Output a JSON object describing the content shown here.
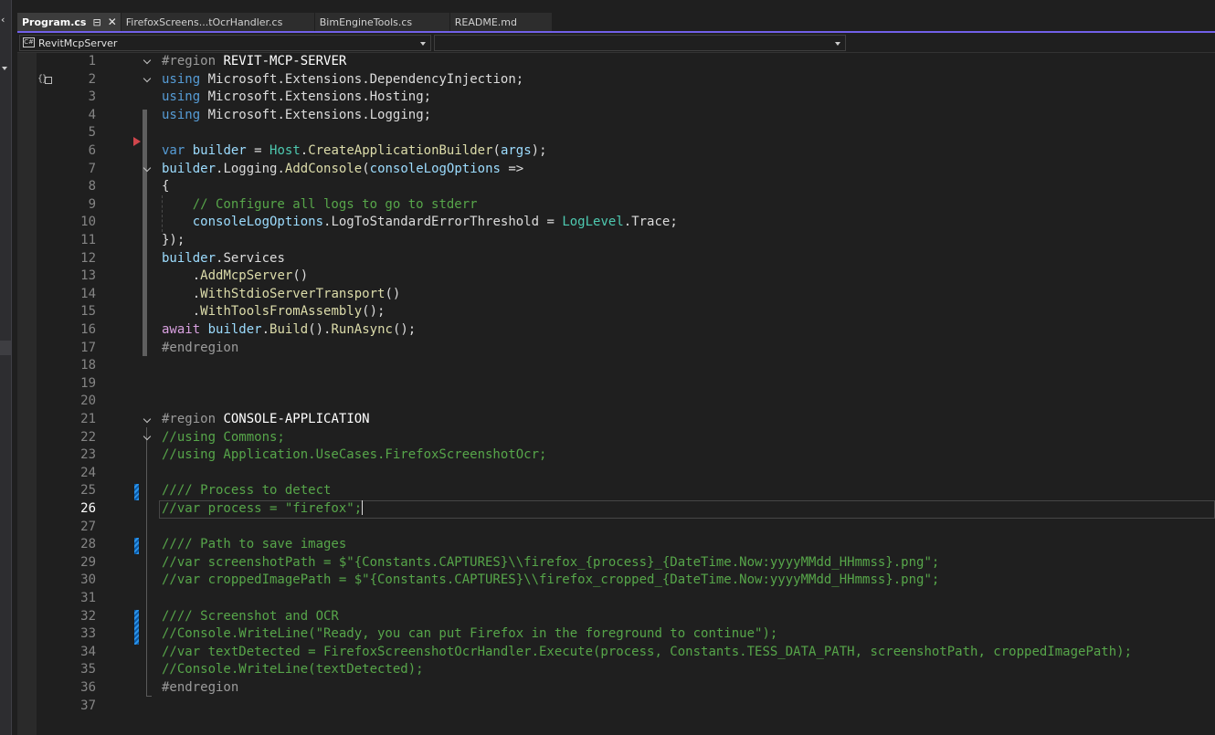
{
  "tabs": [
    {
      "label": "Program.cs",
      "active": true,
      "pin_icon": "pin-icon",
      "close_icon": "close-icon"
    },
    {
      "label": "FirefoxScreens...tOcrHandler.cs",
      "active": false
    },
    {
      "label": "BimEngineTools.cs",
      "active": false
    },
    {
      "label": "README.md",
      "active": false
    }
  ],
  "navbar": {
    "project": "RevitMcpServer",
    "project_icon": "csharp-project-icon",
    "member": ""
  },
  "editor": {
    "current_line": 26,
    "colors": {
      "keyword": "#569cd6",
      "type": "#4ec9b0",
      "variable": "#9cdcfe",
      "method": "#dcdcaa",
      "comment": "#57a64a",
      "line_number": "#858585",
      "tab_accent": "#7160e8",
      "change_marker": "#1d7fd1",
      "breakpoint": "#d0464c"
    },
    "lines": [
      {
        "n": "1"
      },
      {
        "n": "2"
      },
      {
        "n": "3"
      },
      {
        "n": "4"
      },
      {
        "n": "5"
      },
      {
        "n": "6"
      },
      {
        "n": "7"
      },
      {
        "n": "8"
      },
      {
        "n": "9"
      },
      {
        "n": "10"
      },
      {
        "n": "11"
      },
      {
        "n": "12"
      },
      {
        "n": "13"
      },
      {
        "n": "14"
      },
      {
        "n": "15"
      },
      {
        "n": "16"
      },
      {
        "n": "17"
      },
      {
        "n": "18"
      },
      {
        "n": "19"
      },
      {
        "n": "20"
      },
      {
        "n": "21"
      },
      {
        "n": "22"
      },
      {
        "n": "23"
      },
      {
        "n": "24"
      },
      {
        "n": "25"
      },
      {
        "n": "26"
      },
      {
        "n": "27"
      },
      {
        "n": "28"
      },
      {
        "n": "29"
      },
      {
        "n": "30"
      },
      {
        "n": "31"
      },
      {
        "n": "32"
      },
      {
        "n": "33"
      },
      {
        "n": "34"
      },
      {
        "n": "35"
      },
      {
        "n": "36"
      },
      {
        "n": "37"
      }
    ],
    "tokens": {
      "l1": [
        "#region",
        "REVIT-MCP-SERVER"
      ],
      "l2": [
        "using",
        "Microsoft",
        ".",
        "Extensions",
        ".",
        "DependencyInjection",
        ";"
      ],
      "l3": [
        "using",
        "Microsoft",
        ".",
        "Extensions",
        ".",
        "Hosting",
        ";"
      ],
      "l4": [
        "using",
        "Microsoft",
        ".",
        "Extensions",
        ".",
        "Logging",
        ";"
      ],
      "l6": [
        "var",
        "builder",
        " = ",
        "Host",
        ".",
        "CreateApplicationBuilder",
        "(",
        "args",
        ");"
      ],
      "l7": [
        "builder",
        ".",
        "Logging",
        ".",
        "AddConsole",
        "(",
        "consoleLogOptions",
        " =>"
      ],
      "l8": [
        "{"
      ],
      "l9": [
        "// Configure all logs to go to stderr"
      ],
      "l10": [
        "consoleLogOptions",
        ".",
        "LogToStandardErrorThreshold",
        " = ",
        "LogLevel",
        ".",
        "Trace",
        ";"
      ],
      "l11": [
        "});"
      ],
      "l12": [
        "builder",
        ".",
        "Services"
      ],
      "l13": [
        ".",
        "AddMcpServer",
        "()"
      ],
      "l14": [
        ".",
        "WithStdioServerTransport",
        "()"
      ],
      "l15": [
        ".",
        "WithToolsFromAssembly",
        "();"
      ],
      "l16": [
        "await",
        "builder",
        ".",
        "Build",
        "().",
        "RunAsync",
        "();"
      ],
      "l17": [
        "#endregion"
      ],
      "l21": [
        "#region",
        "CONSOLE-APPLICATION"
      ],
      "l22": [
        "//using Commons;"
      ],
      "l23": [
        "//using Application.UseCases.FirefoxScreenshotOcr;"
      ],
      "l25": [
        "//// Process to detect"
      ],
      "l26": [
        "//var process = \"firefox\";"
      ],
      "l28": [
        "//// Path to save images"
      ],
      "l29": [
        "//var screenshotPath = $\"{Constants.CAPTURES}\\\\firefox_{process}_{DateTime.Now:yyyyMMdd_HHmmss}.png\";"
      ],
      "l30": [
        "//var croppedImagePath = $\"{Constants.CAPTURES}\\\\firefox_cropped_{DateTime.Now:yyyyMMdd_HHmmss}.png\";"
      ],
      "l32": [
        "//// Screenshot and OCR"
      ],
      "l33": [
        "//Console.WriteLine(\"Ready, you can put Firefox in the foreground to continue\");"
      ],
      "l34": [
        "//var textDetected = FirefoxScreenshotOcrHandler.Execute(process, Constants.TESS_DATA_PATH, screenshotPath, croppedImagePath);"
      ],
      "l35": [
        "//Console.WriteLine(textDetected);"
      ],
      "l36": [
        "#endregion"
      ]
    }
  }
}
